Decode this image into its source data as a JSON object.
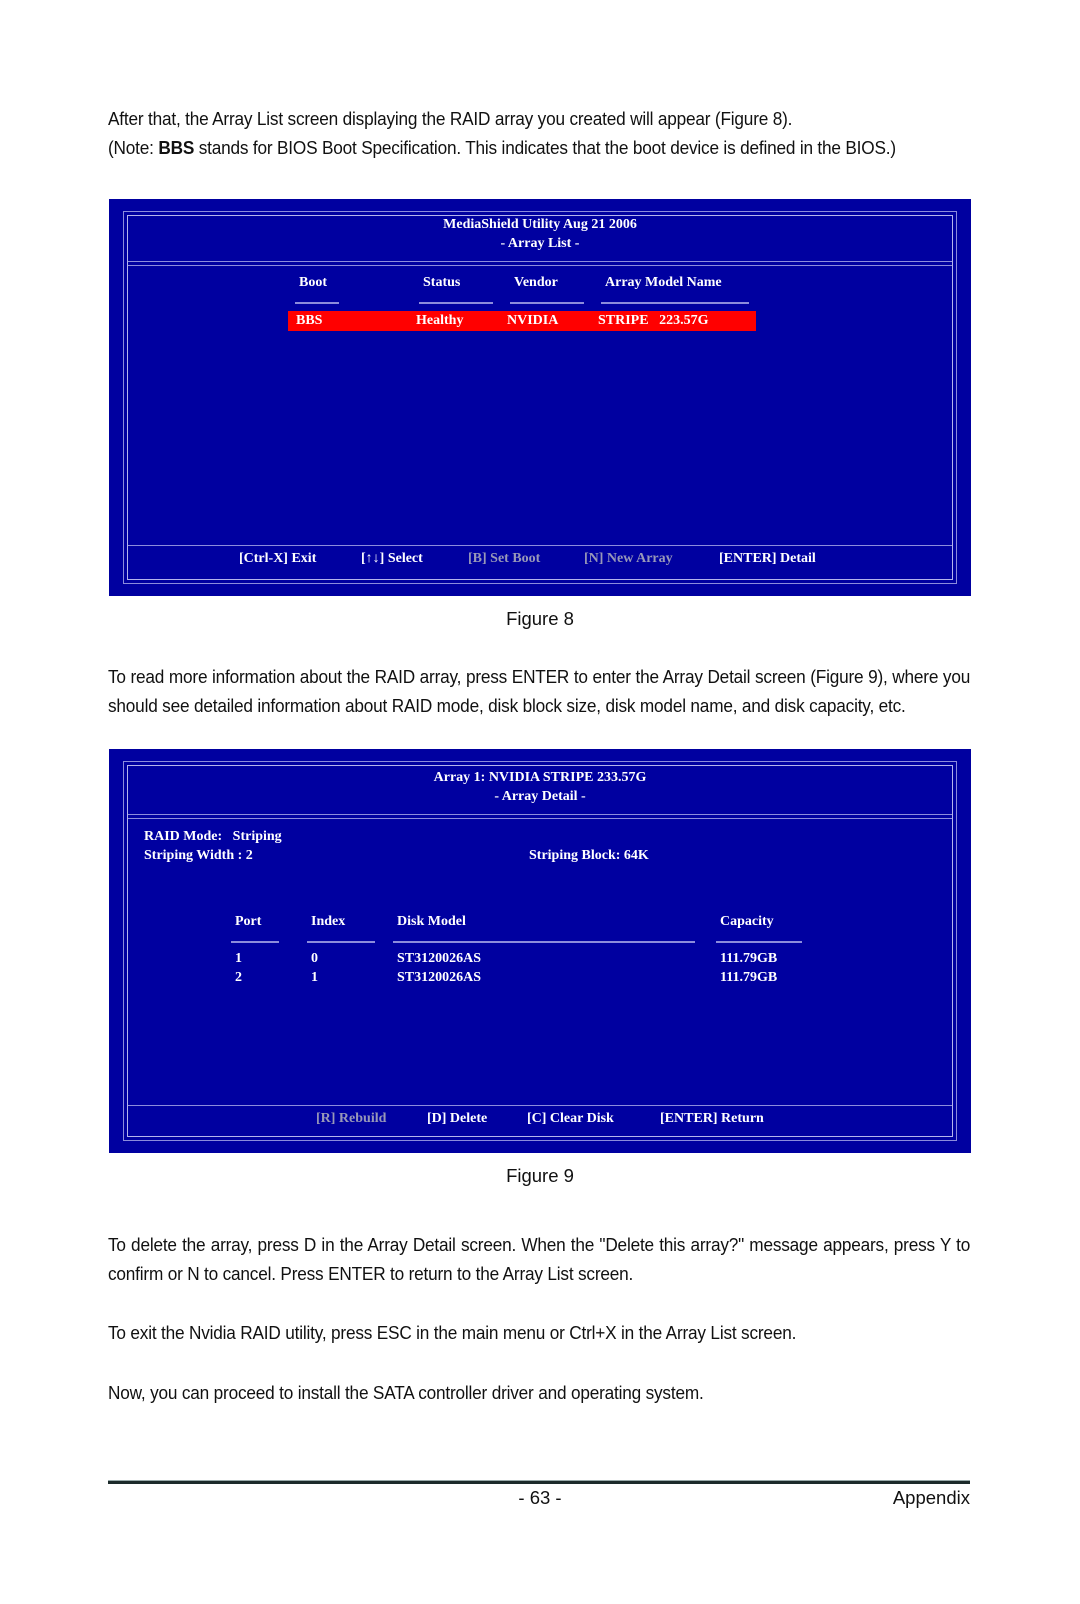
{
  "intro": {
    "line1": "After that, the Array List screen displaying the RAID array you created will appear (Figure 8).",
    "note_prefix": "(Note: ",
    "note_bold": "BBS",
    "note_rest": " stands for BIOS Boot Specification. This indicates that the boot device is defined in the BIOS.)"
  },
  "figure8": {
    "title": "MediaShield Utility Aug 21 2006",
    "subtitle": "- Array List -",
    "columns": [
      "Boot",
      "Status",
      "Vendor",
      "Array Model Name"
    ],
    "rows": [
      {
        "boot": "BBS",
        "status": "Healthy",
        "vendor": "NVIDIA",
        "model": "STRIPE   223.57G",
        "selected": true
      }
    ],
    "keys": [
      {
        "label": "[Ctrl-X] Exit",
        "enabled": true
      },
      {
        "label": "[↑↓] Select",
        "enabled": true
      },
      {
        "label": "[B] Set Boot",
        "enabled": false
      },
      {
        "label": "[N] New Array",
        "enabled": false
      },
      {
        "label": "[ENTER] Detail",
        "enabled": true
      }
    ],
    "caption": "Figure 8"
  },
  "para2": "To read more information about the RAID array, press ENTER to enter the Array Detail screen (Figure 9), where you should see detailed information about RAID mode, disk block size, disk model name, and disk capacity, etc.",
  "figure9": {
    "title": "Array 1: NVIDIA STRIPE 233.57G",
    "subtitle": "- Array Detail -",
    "raid_mode": "RAID Mode:   Striping",
    "striping_width": "Striping Width : 2",
    "striping_block": "Striping Block: 64K",
    "columns": [
      "Port",
      "Index",
      "Disk Model",
      "Capacity"
    ],
    "rows": [
      {
        "port": "1",
        "index": "0",
        "model": "ST3120026AS",
        "capacity": "111.79GB"
      },
      {
        "port": "2",
        "index": "1",
        "model": "ST3120026AS",
        "capacity": "111.79GB"
      }
    ],
    "keys": [
      {
        "label": "[R] Rebuild",
        "enabled": false
      },
      {
        "label": "[D] Delete",
        "enabled": true
      },
      {
        "label": "[C] Clear Disk",
        "enabled": true
      },
      {
        "label": "[ENTER] Return",
        "enabled": true
      }
    ],
    "caption": "Figure 9"
  },
  "para3": "To delete the array, press D in the Array Detail screen. When the \"Delete this array?\" message appears, press Y to confirm or N to cancel. Press ENTER to return to the Array List screen.",
  "para4": "To exit the Nvidia RAID utility, press ESC in the main menu or Ctrl+X in the Array List screen.",
  "para5": "Now, you can proceed to install the SATA controller driver and operating system.",
  "footer": {
    "page_number": "- 63 -",
    "section": "Appendix"
  },
  "colors": {
    "bios_blue": "#0000a0",
    "highlight_red": "#ff0000",
    "disabled_text": "#9898b8"
  }
}
